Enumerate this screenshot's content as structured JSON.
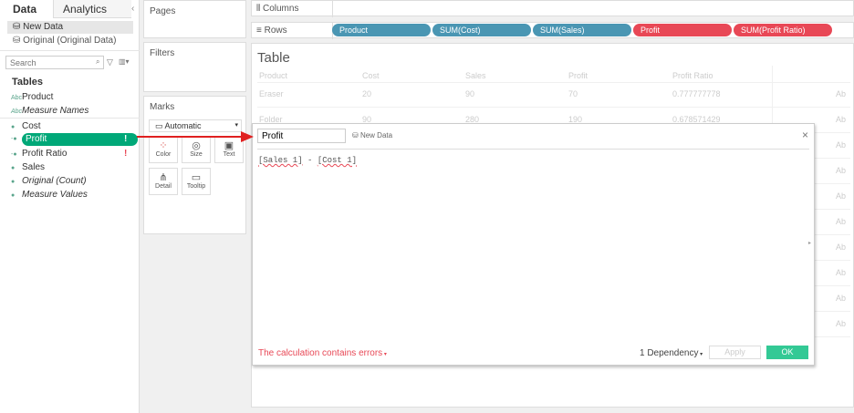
{
  "left": {
    "tabs": [
      "Data",
      "Analytics"
    ],
    "collapse": "‹",
    "sources": [
      "New Data",
      "Original (Original Data)"
    ],
    "search_placeholder": "Search",
    "tables_label": "Tables",
    "dims": [
      "Product",
      "Measure Names"
    ],
    "measures": [
      "Cost",
      "Profit",
      "Profit Ratio",
      "Sales",
      "Original (Count)",
      "Measure Values"
    ],
    "error_mark": "!"
  },
  "middle": {
    "pages": "Pages",
    "filters": "Filters",
    "marks": "Marks",
    "mark_type": "Automatic",
    "buttons": [
      "Color",
      "Size",
      "Text",
      "Detail",
      "Tooltip"
    ]
  },
  "shelves": {
    "columns": "Columns",
    "rows": "Rows",
    "pills": [
      "Product",
      "SUM(Cost)",
      "SUM(Sales)",
      "Profit",
      "SUM(Profit Ratio)"
    ]
  },
  "sheet": {
    "title": "Table",
    "headers": [
      "Product",
      "Cost",
      "Sales",
      "Profit",
      "Profit Ratio"
    ],
    "rows": [
      [
        "Eraser",
        "20",
        "90",
        "70",
        "0.777777778"
      ],
      [
        "Folder",
        "90",
        "280",
        "190",
        "0.678571429"
      ]
    ],
    "abc": "Ab"
  },
  "calc": {
    "name": "Profit",
    "source": "New Data",
    "formula_a": "[Sales 1]",
    "op": " - ",
    "formula_b": "[Cost 1]",
    "error": "The calculation contains errors",
    "dependency": "1 Dependency",
    "apply": "Apply",
    "ok": "OK",
    "close": "×"
  },
  "colors": {
    "green": "#00a878",
    "red": "#e84856",
    "blue": "#4a96b3",
    "ok": "#33c995"
  }
}
